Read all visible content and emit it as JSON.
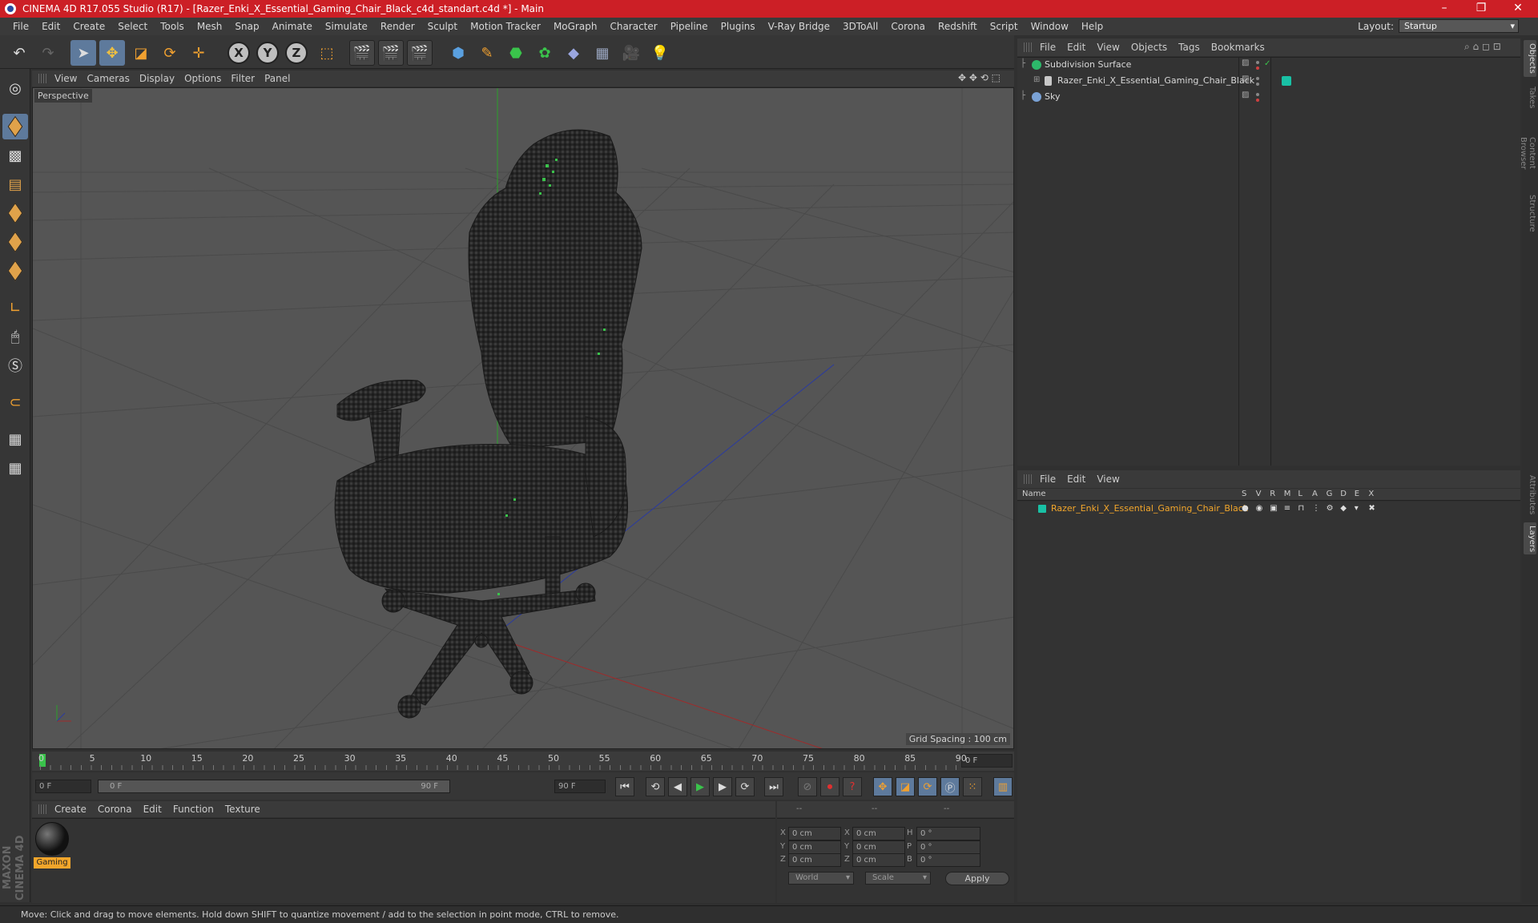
{
  "window": {
    "title": "CINEMA 4D R17.055 Studio (R17) - [Razer_Enki_X_Essential_Gaming_Chair_Black_c4d_standart.c4d *] - Main",
    "controls": [
      "–",
      "❐",
      "✕"
    ]
  },
  "menubar": [
    "File",
    "Edit",
    "Create",
    "Select",
    "Tools",
    "Mesh",
    "Snap",
    "Animate",
    "Simulate",
    "Render",
    "Sculpt",
    "Motion Tracker",
    "MoGraph",
    "Character",
    "Pipeline",
    "Plugins",
    "V-Ray Bridge",
    "3DToAll",
    "Corona",
    "Redshift",
    "Script",
    "Window",
    "Help"
  ],
  "layout": {
    "label": "Layout:",
    "value": "Startup"
  },
  "toolbar": {
    "x_label": "X",
    "y_label": "Y",
    "z_label": "Z"
  },
  "viewport": {
    "menu": [
      "View",
      "Cameras",
      "Display",
      "Options",
      "Filter",
      "Panel"
    ],
    "label": "Perspective",
    "grid_spacing": "Grid Spacing : 100 cm"
  },
  "timeline": {
    "ticks": [
      "0",
      "5",
      "10",
      "15",
      "20",
      "25",
      "30",
      "35",
      "40",
      "45",
      "50",
      "55",
      "60",
      "65",
      "70",
      "75",
      "80",
      "85",
      "90"
    ],
    "current_frame": "0 F"
  },
  "transport": {
    "start_field": "0 F",
    "range_start": "0 F",
    "range_end": "90 F",
    "end_field": "90 F"
  },
  "material_manager": {
    "menu": [
      "Create",
      "Corona",
      "Edit",
      "Function",
      "Texture"
    ],
    "material_name": "Gaming"
  },
  "coordinates": {
    "header": [
      "--",
      "--",
      "--"
    ],
    "rows": [
      {
        "a": "X",
        "av": "0 cm",
        "b": "X",
        "bv": "0 cm",
        "c": "H",
        "cv": "0 °"
      },
      {
        "a": "Y",
        "av": "0 cm",
        "b": "Y",
        "bv": "0 cm",
        "c": "P",
        "cv": "0 °"
      },
      {
        "a": "Z",
        "av": "0 cm",
        "b": "Z",
        "bv": "0 cm",
        "c": "B",
        "cv": "0 °"
      }
    ],
    "space": "World",
    "mode": "Scale",
    "apply": "Apply"
  },
  "object_manager": {
    "menu": [
      "File",
      "Edit",
      "View",
      "Objects",
      "Tags",
      "Bookmarks"
    ],
    "objects": [
      {
        "name": "Subdivision Surface",
        "icon_color": "#2db86a"
      },
      {
        "name": "Razer_Enki_X_Essential_Gaming_Chair_Black",
        "icon_color": "#c8c8c8",
        "tag_color": "#19c1a5"
      },
      {
        "name": "Sky",
        "icon_color": "#7aa2d6"
      }
    ]
  },
  "layer_manager": {
    "menu": [
      "File",
      "Edit",
      "View"
    ],
    "columns": [
      "Name",
      "S",
      "V",
      "R",
      "M",
      "L",
      "A",
      "G",
      "D",
      "E",
      "X"
    ],
    "layers": [
      {
        "name": "Razer_Enki_X_Essential_Gaming_Chair_Black",
        "color": "#19c1a5"
      }
    ]
  },
  "side_tabs": [
    "Objects",
    "Takes",
    "Content Browser",
    "Structure",
    "Attributes",
    "Layers"
  ],
  "status": "Move: Click and drag to move elements. Hold down SHIFT to quantize movement / add to the selection in point mode, CTRL to remove.",
  "brand": "MAXON CINEMA 4D",
  "colors": {
    "title_bar": "#cc1f26",
    "accent": "#5e7a9c",
    "material_label": "#f2a62b",
    "layer_name": "#f2a62b"
  }
}
